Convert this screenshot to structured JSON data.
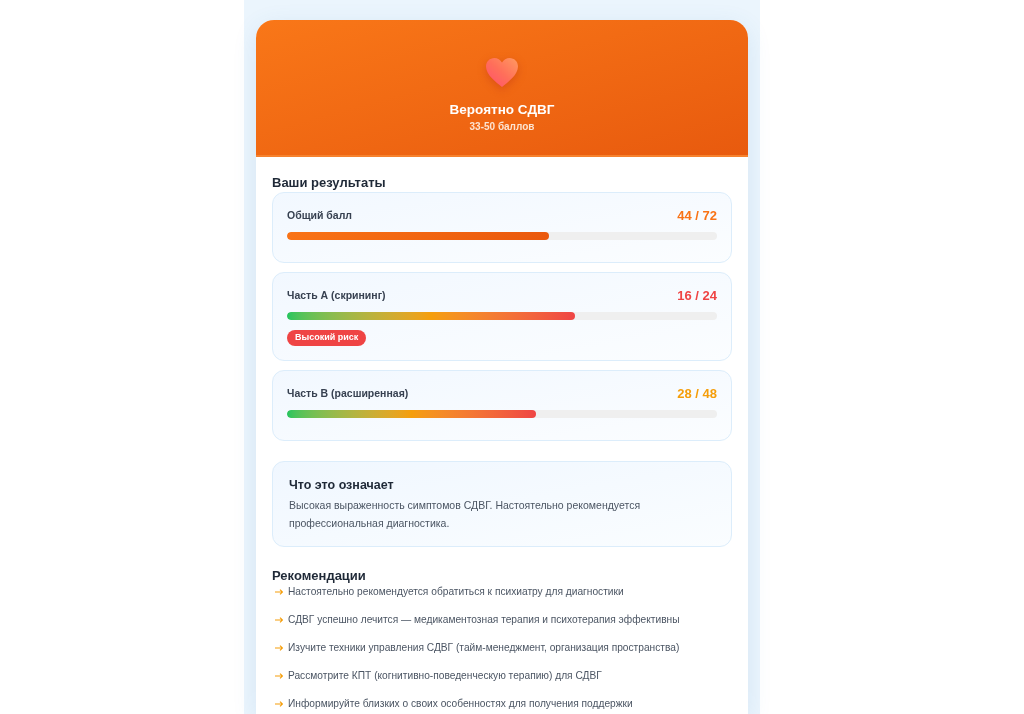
{
  "header": {
    "title": "Вероятно СДВГ",
    "subtitle": "33-50 баллов"
  },
  "results": {
    "heading": "Ваши результаты",
    "items": [
      {
        "label": "Общий балл",
        "score": "44 / 72",
        "color": "#f97316",
        "kind": "solid",
        "level": 0.61
      },
      {
        "label": "Часть А (скрининг)",
        "score": "16 / 24",
        "color": "#ef4444",
        "kind": "gradient",
        "level": 0.67,
        "badge": "Высокий риск"
      },
      {
        "label": "Часть В (расширенная)",
        "score": "28 / 48",
        "color": "#f59e0b",
        "kind": "gradient",
        "level": 0.58
      }
    ]
  },
  "meaning": {
    "title": "Что это означает",
    "text": "Высокая выраженность симптомов СДВГ. Настоятельно рекомендуется профессиональная диагностика."
  },
  "recommendations": {
    "heading": "Рекомендации",
    "items": [
      "Настоятельно рекомендуется обратиться к психиатру для диагностики",
      "СДВГ успешно лечится — медикаментозная терапия и психотерапия эффективны",
      "Изучите техники управления СДВГ (тайм-менеджмент, организация пространства)",
      "Рассмотрите КПТ (когнитивно-поведенческую терапию) для СДВГ",
      "Информируйте близких о своих особенностях для получения поддержки"
    ]
  }
}
